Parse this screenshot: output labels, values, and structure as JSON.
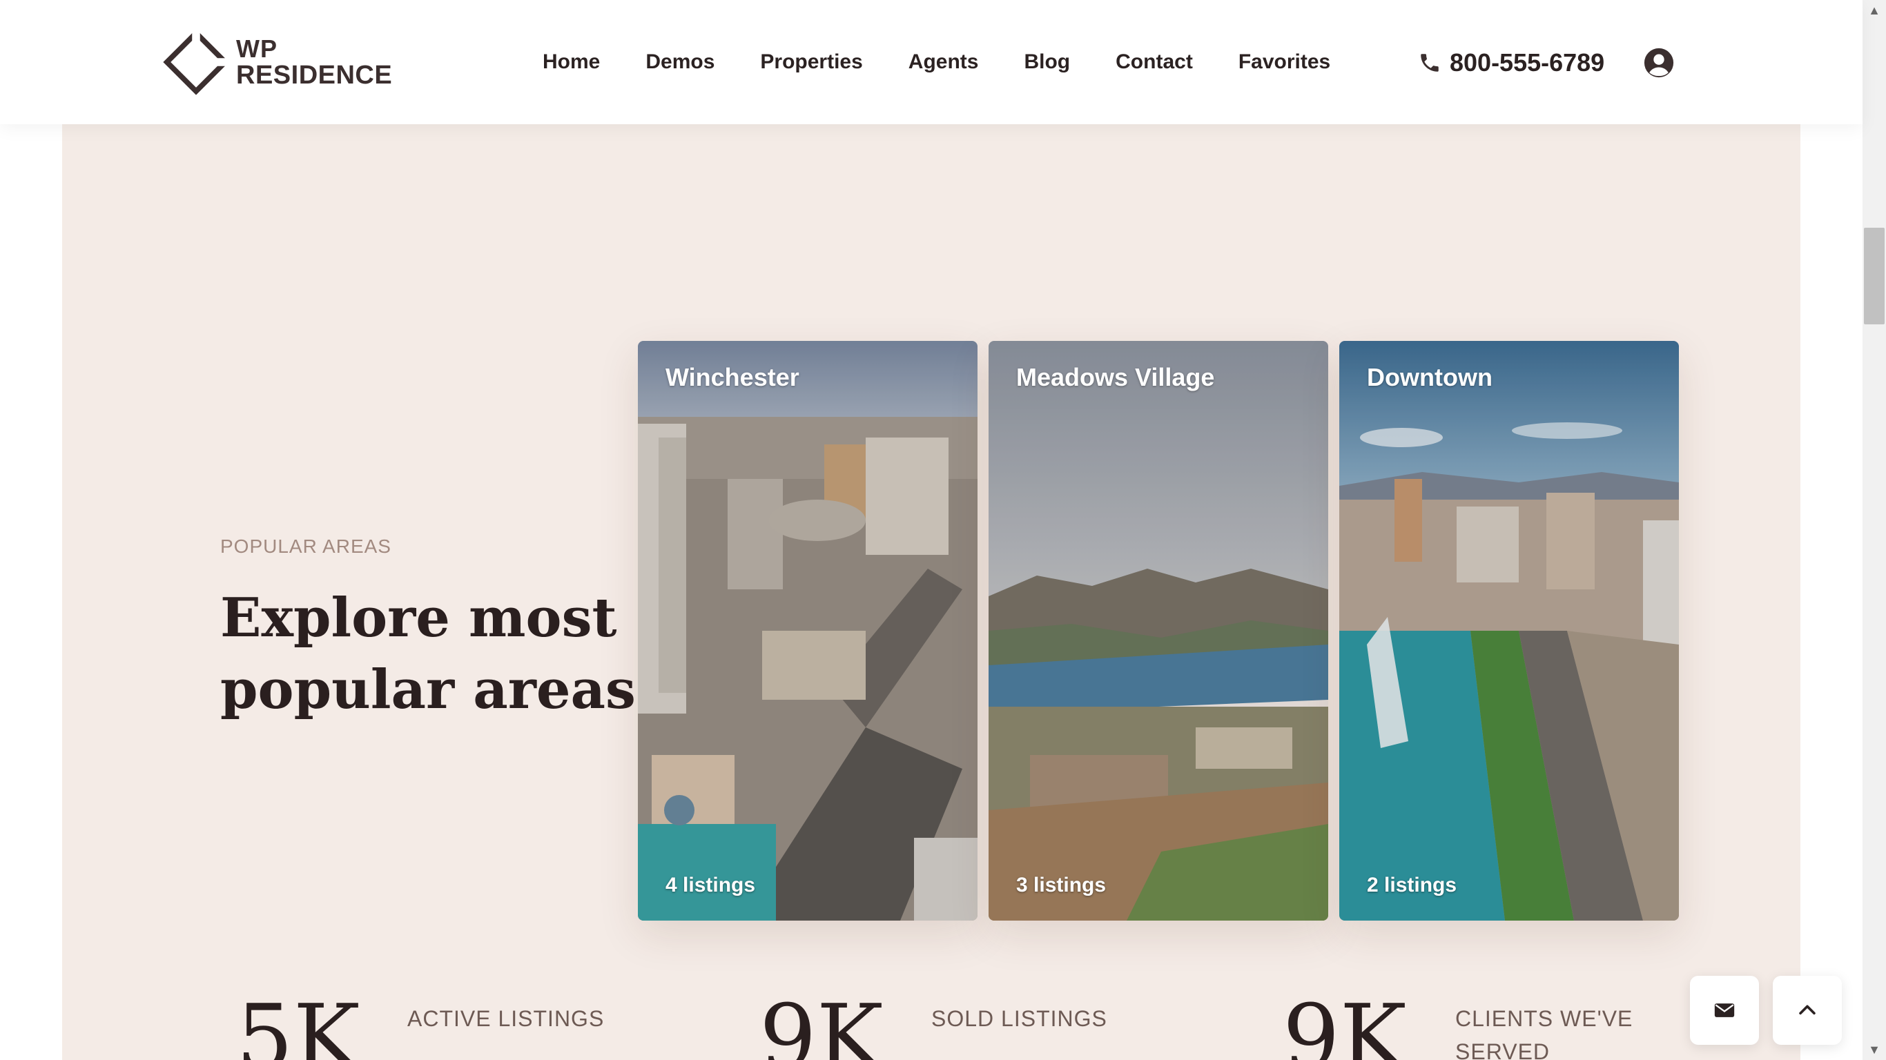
{
  "brand": {
    "line1": "WP",
    "line2": "RESIDENCE",
    "color": "#3b2f2f"
  },
  "nav": {
    "items": [
      "Home",
      "Demos",
      "Properties",
      "Agents",
      "Blog",
      "Contact",
      "Favorites"
    ]
  },
  "contact": {
    "phone": "800-555-6789",
    "phone_icon": "phone-icon",
    "user_icon": "user-circle-icon"
  },
  "section": {
    "eyebrow": "POPULAR AREAS",
    "headline": "Explore most popular areas",
    "background": "#f4ebe6"
  },
  "areas": [
    {
      "name": "Winchester",
      "count": "4 listings"
    },
    {
      "name": "Meadows Village",
      "count": "3 listings"
    },
    {
      "name": "Downtown",
      "count": "2 listings"
    }
  ],
  "stats": [
    {
      "number": "5K",
      "label": "ACTIVE LISTINGS"
    },
    {
      "number": "9K",
      "label": "SOLD LISTINGS"
    },
    {
      "number": "9K",
      "label": "CLIENTS WE'VE SERVED"
    }
  ],
  "floating": {
    "mail_icon": "envelope-icon",
    "top_icon": "chevron-up-icon"
  }
}
